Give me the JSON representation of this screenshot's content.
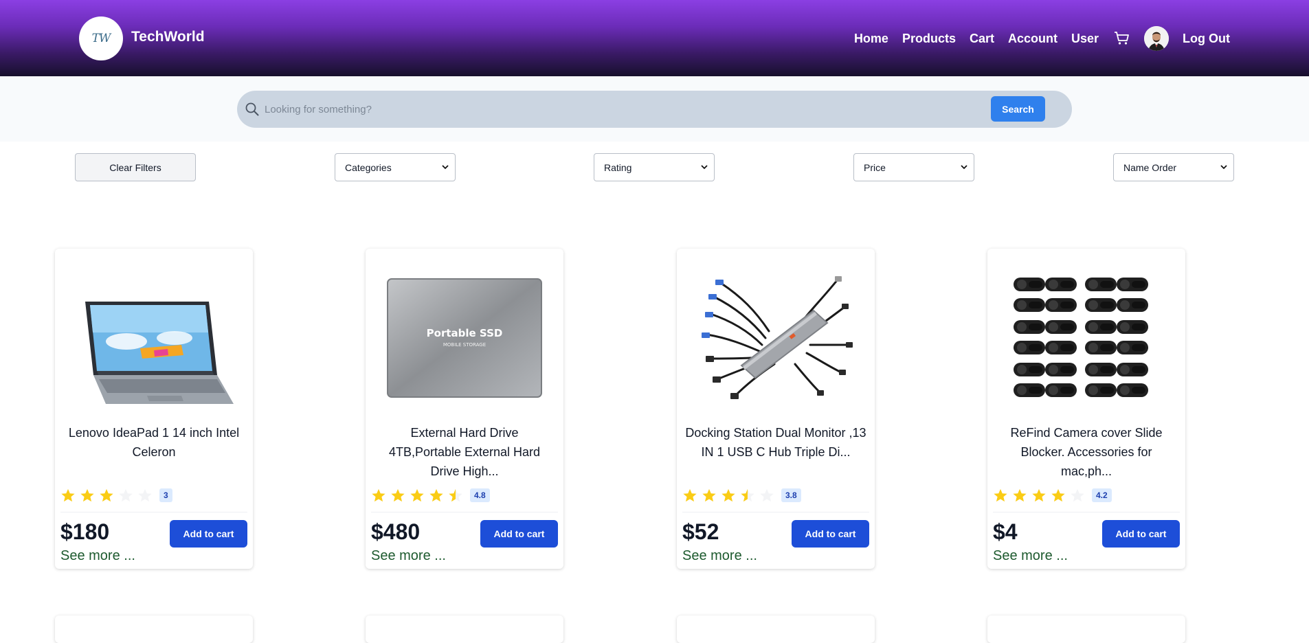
{
  "brand": {
    "logo_text": "TW",
    "name": "TechWorld"
  },
  "nav": {
    "items": [
      "Home",
      "Products",
      "Cart",
      "Account",
      "User"
    ],
    "cart_icon": "shopping-cart-icon",
    "avatar_icon": "user-avatar",
    "logout": "Log Out"
  },
  "search": {
    "placeholder": "Looking for something?",
    "value": "",
    "button": "Search",
    "icon": "search-icon"
  },
  "filters": {
    "clear": "Clear Filters",
    "categories": "Categories",
    "rating": "Rating",
    "price": "Price",
    "name_order": "Name Order"
  },
  "products": [
    {
      "title": "Lenovo IdeaPad 1 14 inch Intel Celeron",
      "rating": 3,
      "rating_label": "3",
      "price": "$180",
      "add": "Add to cart",
      "more": "See more ...",
      "image": "laptop-image"
    },
    {
      "title": "External Hard Drive 4TB,Portable External Hard Drive High...",
      "rating": 4.8,
      "rating_label": "4.8",
      "price": "$480",
      "add": "Add to cart",
      "more": "See more ...",
      "image": "portable-ssd-image",
      "image_text": "Portable SSD",
      "image_subtext": "MOBILE STORAGE"
    },
    {
      "title": "Docking Station Dual Monitor ,13 IN 1 USB C Hub Triple Di...",
      "rating": 3.8,
      "rating_label": "3.8",
      "price": "$52",
      "add": "Add to cart",
      "more": "See more ...",
      "image": "docking-station-image"
    },
    {
      "title": "ReFind Camera cover Slide Blocker. Accessories for mac,ph...",
      "rating": 4.2,
      "rating_label": "4.2",
      "price": "$4",
      "add": "Add to cart",
      "more": "See more ...",
      "image": "camera-cover-image"
    }
  ],
  "colors": {
    "header_top": "#8b3fe3",
    "header_bottom": "#170f2c",
    "accent": "#1d4ed8",
    "search_button": "#2f80ed",
    "star": "#facc15",
    "star_empty": "#f3f4f6",
    "see_more": "#1d5a2e"
  }
}
